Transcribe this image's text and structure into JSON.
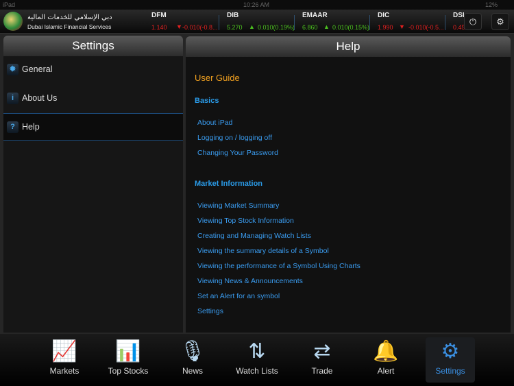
{
  "status": {
    "device": "iPad",
    "time": "10:26 AM",
    "battery": "12%"
  },
  "brand": {
    "arabic": "دبي الإسلامي للخدمات المالية",
    "english": "Dubai Islamic Financial Services"
  },
  "ticker": [
    {
      "symbol": "DFM",
      "price": "1.140",
      "direction": "down",
      "change": "-0.010(-0.8..."
    },
    {
      "symbol": "DIB",
      "price": "5.270",
      "direction": "up",
      "change": "0.010(0.19%)"
    },
    {
      "symbol": "EMAAR",
      "price": "6.860",
      "direction": "up",
      "change": "0.010(0.15%)"
    },
    {
      "symbol": "DIC",
      "price": "1.990",
      "direction": "down",
      "change": "-0.010(-0.5..."
    },
    {
      "symbol": "DSI",
      "price": "0.45",
      "direction": "down",
      "change": ""
    }
  ],
  "settings": {
    "title": "Settings",
    "items": [
      {
        "label": "General",
        "icon": "gear"
      },
      {
        "label": "About Us",
        "icon": "i"
      },
      {
        "label": "Help",
        "icon": "?"
      }
    ],
    "selected": "Help"
  },
  "help": {
    "title": "Help",
    "guide": "User Guide",
    "sections": [
      {
        "title": "Basics",
        "links": [
          "About iPad",
          "Logging on / logging off",
          "Changing Your Password"
        ]
      },
      {
        "title": "Market Information",
        "links": [
          "Viewing Market Summary",
          "Viewing Top Stock Information",
          "Creating and Managing Watch Lists",
          "Viewing the summary details of a Symbol",
          "Viewing the performance of a Symbol Using Charts",
          "Viewing News & Announcements",
          "Set an Alert for an symbol",
          "Settings"
        ]
      }
    ]
  },
  "tabs": [
    {
      "label": "Markets",
      "icon": "markets-chart"
    },
    {
      "label": "Top Stocks",
      "icon": "bar-chart"
    },
    {
      "label": "News",
      "icon": "microphone"
    },
    {
      "label": "Watch Lists",
      "icon": "up-down-arrows"
    },
    {
      "label": "Trade",
      "icon": "exchange"
    },
    {
      "label": "Alert",
      "icon": "bell"
    },
    {
      "label": "Settings",
      "icon": "gear"
    }
  ],
  "colors": {
    "accent": "#3a8ee0",
    "guide": "#f0a020",
    "up": "#4cc020",
    "down": "#e02020"
  }
}
